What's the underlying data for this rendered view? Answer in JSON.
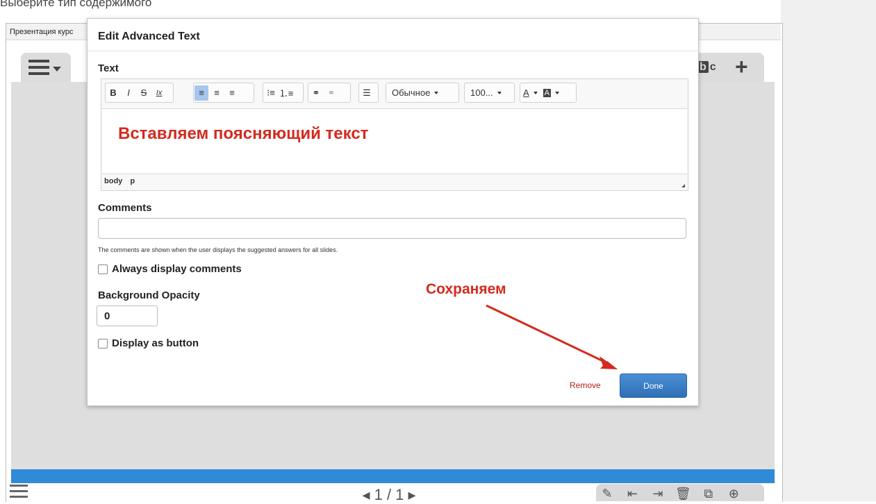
{
  "page": {
    "heading": "Выберите тип содержимого",
    "tab_label": "Презентация курс"
  },
  "editor_chrome": {
    "menu_icon": "hamburger-dropdown-icon",
    "bc_icon_label": "bc",
    "plus_icon": "plus-icon"
  },
  "bottom_bar": {
    "pager": "◂ 1 / 1 ▸",
    "tools": [
      "brush-icon",
      "slide-back-icon",
      "slide-forward-icon",
      "trash-icon",
      "clone-icon",
      "add-circle-icon"
    ]
  },
  "dialog": {
    "title": "Edit Advanced Text",
    "text_label": "Text",
    "toolbar": {
      "bold": "B",
      "italic": "I",
      "strike": "S",
      "clear_format": "Ix",
      "style_select": "Обычное",
      "size_select": "100...",
      "font_color": "A",
      "bg_color": "A"
    },
    "content": "Вставляем поясняющий текст",
    "path": [
      "body",
      "p"
    ],
    "comments_label": "Comments",
    "comments_value": "",
    "comments_help": "The comments are shown when the user displays the suggested answers for all slides.",
    "always_display_label": "Always display comments",
    "opacity_label": "Background Opacity",
    "opacity_value": "0",
    "display_button_label": "Display as button",
    "remove_label": "Remove",
    "done_label": "Done"
  },
  "annotation": {
    "text": "Сохраняем",
    "color": "#d42a1f"
  },
  "colors": {
    "accent": "#2f8ad8",
    "done_button": "#3a7cc4",
    "remove": "#b41d17"
  }
}
